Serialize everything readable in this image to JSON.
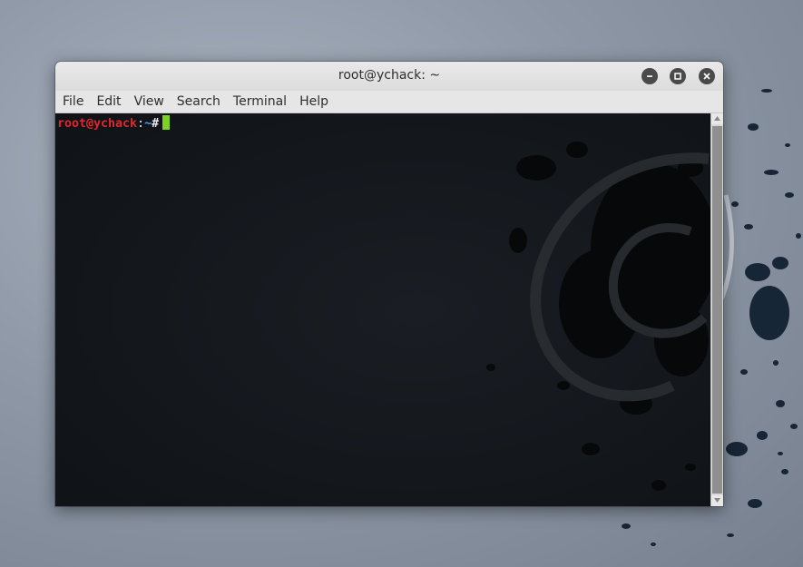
{
  "window": {
    "title": "root@ychack: ~",
    "controls": {
      "minimize_icon": "minimize-icon",
      "maximize_icon": "maximize-icon",
      "close_icon": "close-icon"
    }
  },
  "menu": {
    "items": [
      "File",
      "Edit",
      "View",
      "Search",
      "Terminal",
      "Help"
    ]
  },
  "terminal": {
    "prompt_user_host": "root@ychack",
    "prompt_separator": ":",
    "prompt_dir": "~",
    "prompt_symbol": "#",
    "colors": {
      "user_host": "#e3262c",
      "dir": "#4aa3e8",
      "cursor": "#7ed321",
      "background": "#111418"
    }
  }
}
